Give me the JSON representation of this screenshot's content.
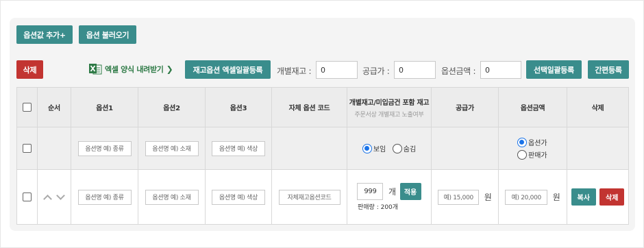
{
  "top_buttons": {
    "add_option_value": "옵션값 추가+",
    "load_options": "옵션 불러오기"
  },
  "toolbar": {
    "delete": "삭제",
    "excel_download": "엑셀 양식 내려받기",
    "excel_bulk_register": "재고옵션 엑셀일괄등록",
    "stock_label": "개별재고 :",
    "stock_value": "0",
    "supply_label": "공급가 :",
    "supply_value": "0",
    "option_price_label": "옵션금액 :",
    "option_price_value": "0",
    "select_bulk_register": "선택일괄등록",
    "simple_register": "간편등록"
  },
  "table": {
    "headers": {
      "order": "순서",
      "option1": "옵션1",
      "option2": "옵션2",
      "option3": "옵션3",
      "own_code": "자체 옵션 코드",
      "stock": "개별재고/미입금건 포함 재고",
      "stock_sub": "주문서상 개별재고 노출여부",
      "supply": "공급가",
      "option_price": "옵션금액",
      "delete": "삭제"
    },
    "bulk_row": {
      "option1_ph": "옵션명 예) 종류",
      "option2_ph": "옵션명 예) 소재",
      "option3_ph": "옵션명 예) 색상",
      "show": "보임",
      "hide": "숨김",
      "option_price_radio": "옵션가",
      "sale_price_radio": "판매가"
    },
    "item_row": {
      "option1_ph": "옵션명 예) 종류",
      "option2_ph": "옵션명 예) 소재",
      "option3_ph": "옵션명 예) 색상",
      "code_ph": "자체재고옵션코드",
      "stock_value": "999",
      "stock_unit": "개",
      "apply": "적용",
      "sales_qty": "판매량 : 200개",
      "supply_ph": "예) 15,000",
      "currency": "원",
      "option_price_ph": "예) 20,000",
      "copy": "복사",
      "delete": "삭제"
    }
  },
  "colors": {
    "teal": "#3a8d8c",
    "red": "#c23431",
    "excel_green": "#2e7a46",
    "radio_blue": "#1a73e8"
  }
}
